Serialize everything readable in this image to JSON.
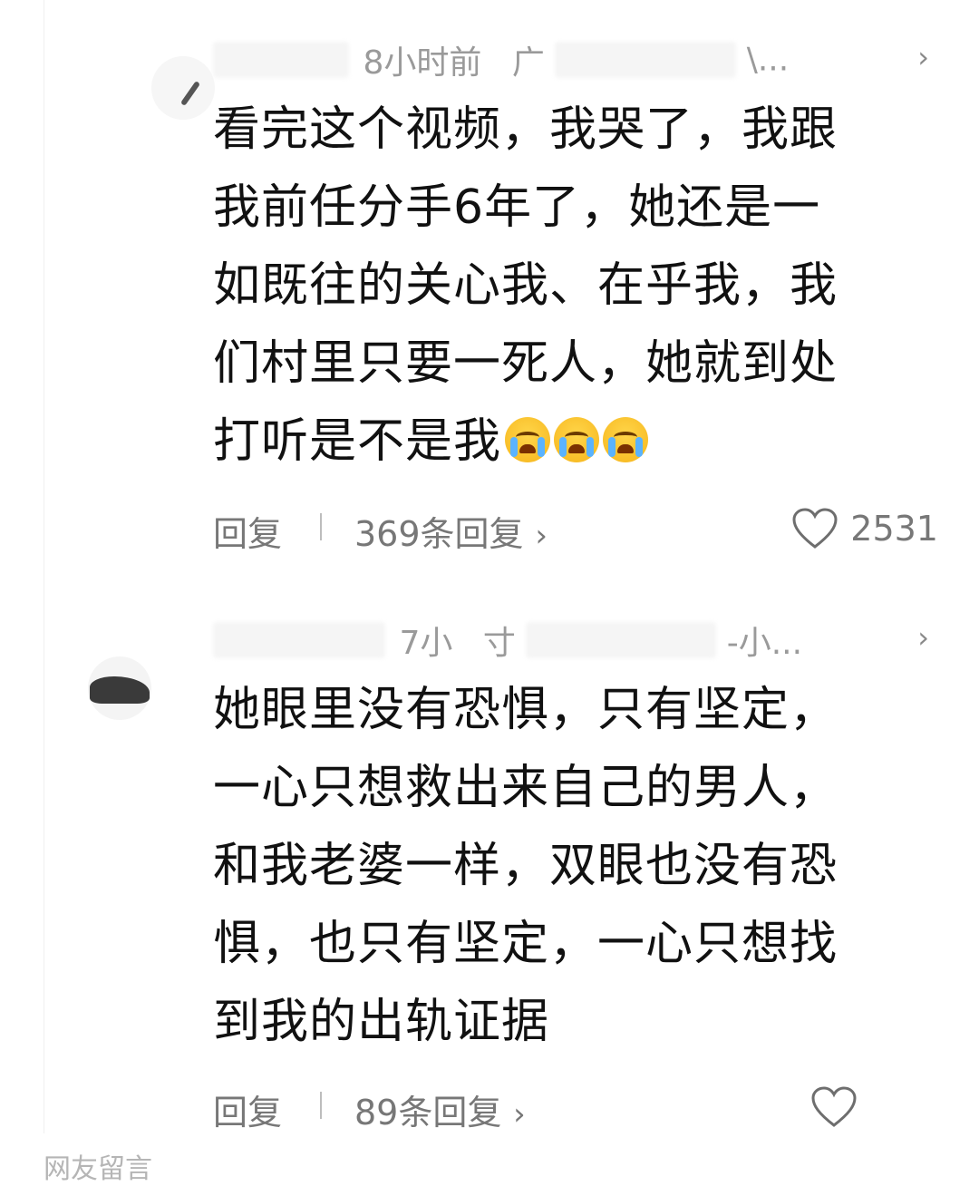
{
  "comments": [
    {
      "time": "8小时前",
      "location": "广",
      "location_tail": "\\...",
      "text_lines": [
        "看完这个视频，我哭了，我跟",
        "我前任分手6年了，她还是一",
        "如既往的关心我、在乎我，我",
        "们村里只要一死人，她就到处",
        "打听是不是我"
      ],
      "emojis": [
        "crying-face-icon",
        "crying-face-icon",
        "crying-face-icon"
      ],
      "reply_label": "回复",
      "replies_label": "369条回复",
      "like_count": "2531"
    },
    {
      "time": "7小",
      "location": "寸",
      "location_tail": "-小...",
      "text_lines": [
        "她眼里没有恐惧，只有坚定，",
        "一心只想救出来自己的男人，",
        "和我老婆一样，双眼也没有恐",
        "惧，也只有坚定，一心只想找",
        "到我的出轨证据"
      ],
      "reply_label": "回复",
      "replies_label": "89条回复",
      "like_count": ""
    }
  ],
  "caption": "网友留言",
  "colors": {
    "text": "#111111",
    "meta": "#9a9a9a",
    "action": "#777777"
  }
}
